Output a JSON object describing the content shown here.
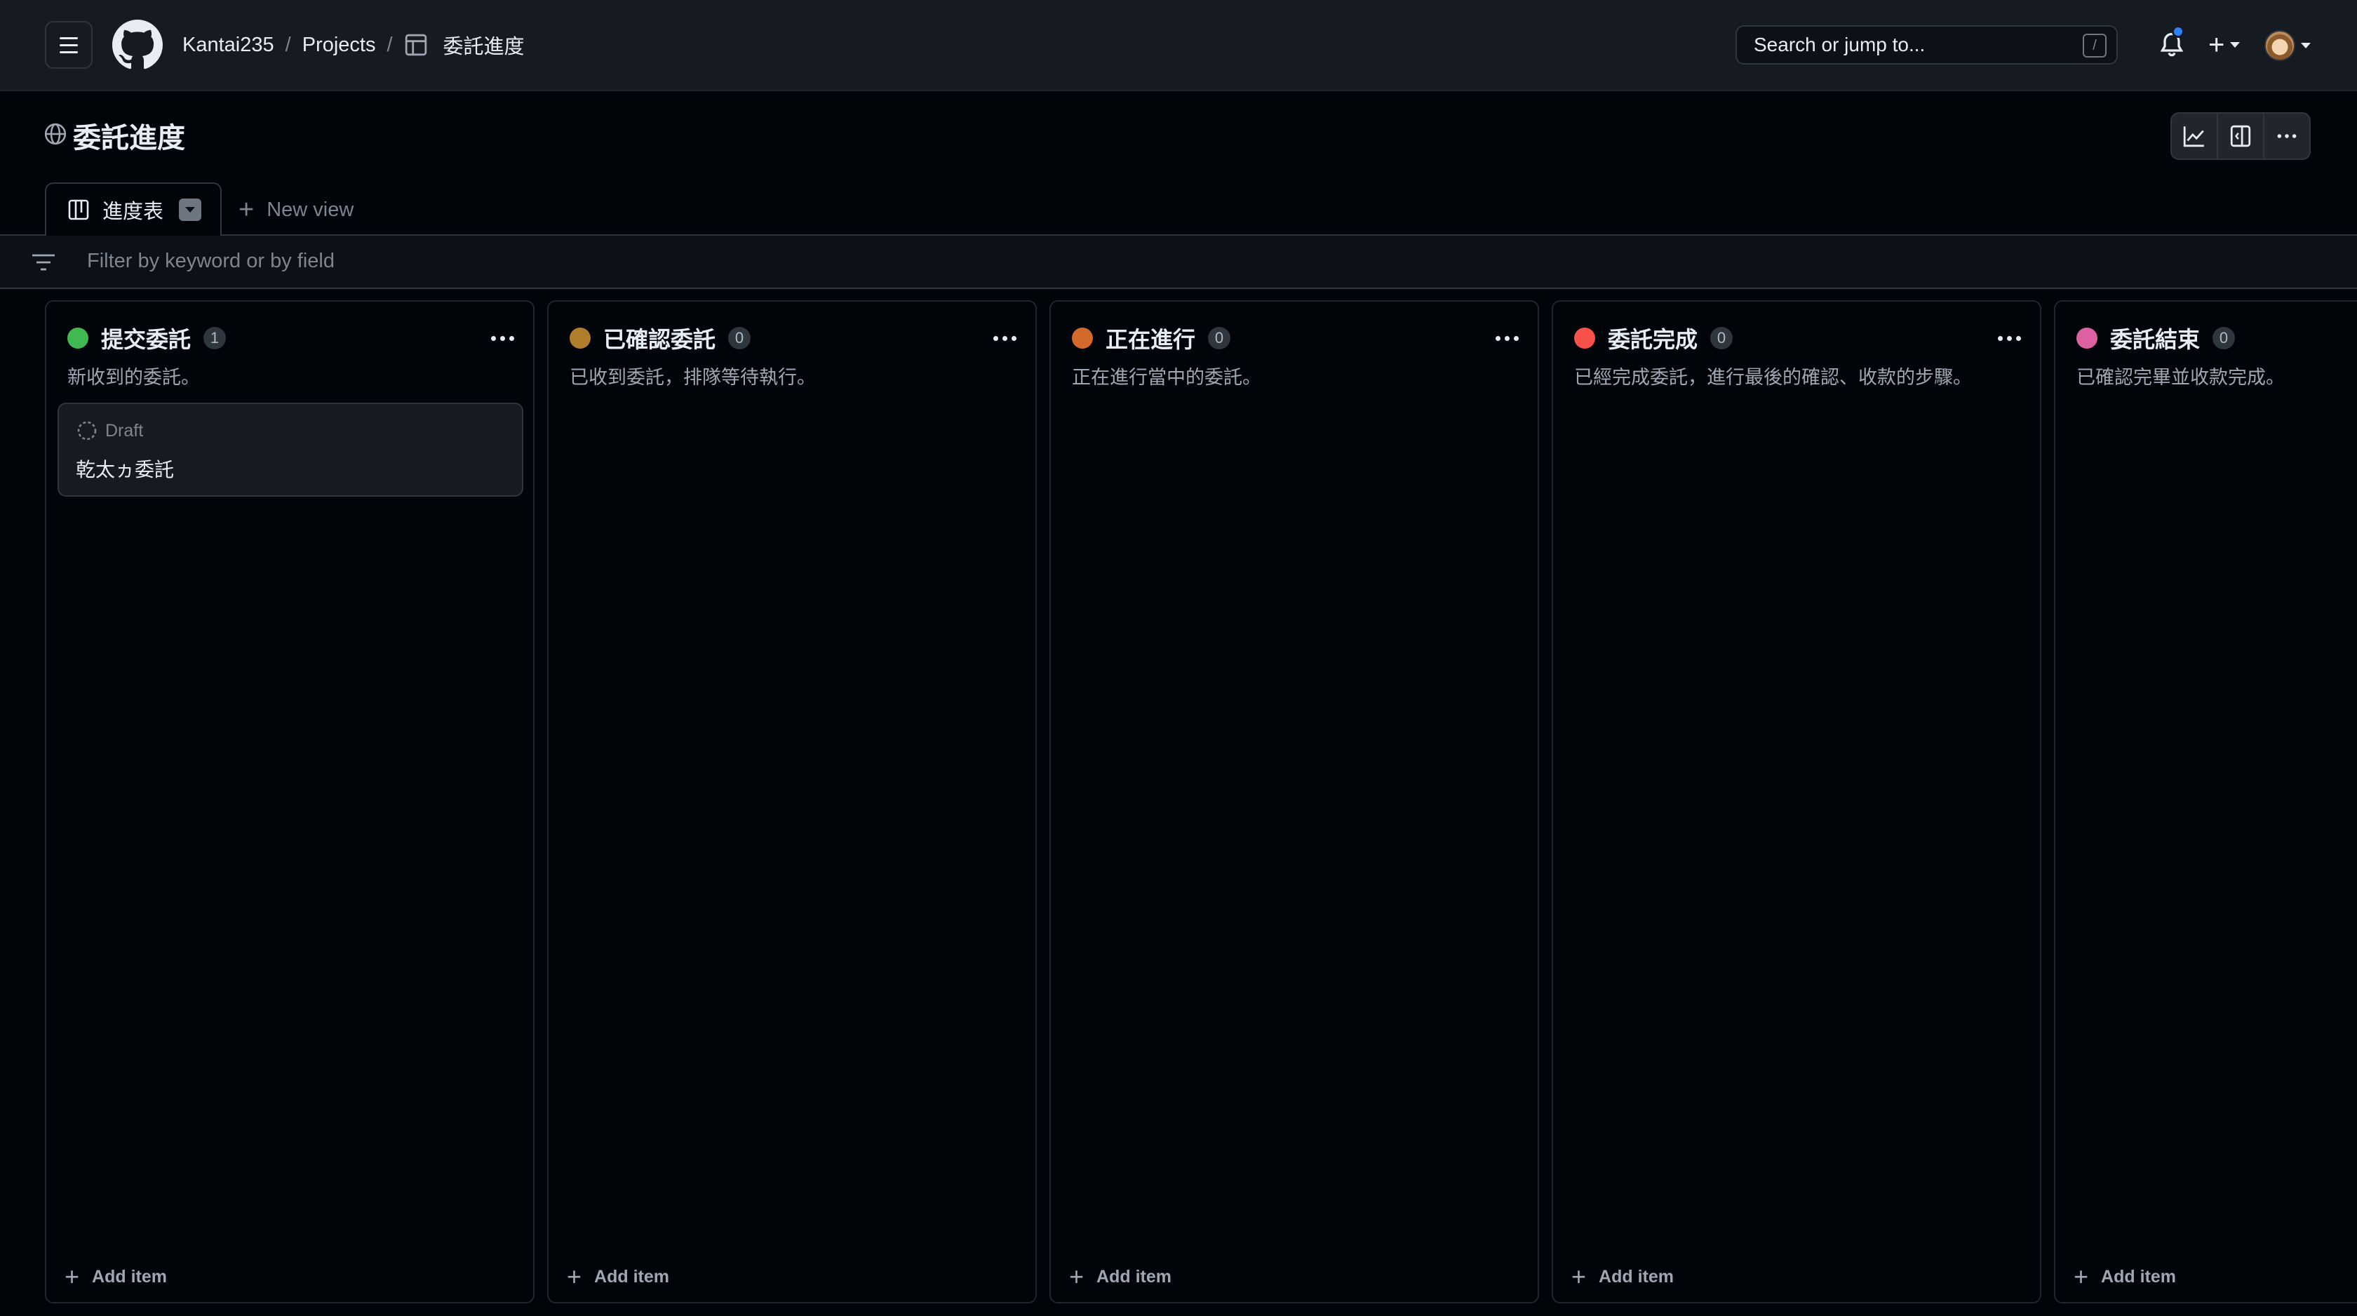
{
  "header": {
    "breadcrumb": {
      "owner": "Kantai235",
      "sep1": "/",
      "projects": "Projects",
      "sep2": "/",
      "current": "委託進度"
    },
    "search_placeholder": "Search or jump to...",
    "search_shortcut": "/",
    "new_button": "+"
  },
  "project": {
    "title": "委託進度"
  },
  "views": {
    "active_tab": "進度表",
    "new_view_label": "New view",
    "new_view_plus": "+"
  },
  "filter": {
    "placeholder": "Filter by keyword or by field"
  },
  "board": {
    "add_item_label": "Add item",
    "add_item_plus": "+",
    "columns": [
      {
        "title": "提交委託",
        "count": "1",
        "description": "新收到的委託。",
        "color": "#3fb950",
        "cards": [
          {
            "type": "Draft",
            "title": "乾太ヵ委託"
          }
        ]
      },
      {
        "title": "已確認委託",
        "count": "0",
        "description": "已收到委託，排隊等待執行。",
        "color": "#b07d2b",
        "cards": []
      },
      {
        "title": "正在進行",
        "count": "0",
        "description": "正在進行當中的委託。",
        "color": "#d2692a",
        "cards": []
      },
      {
        "title": "委託完成",
        "count": "0",
        "description": "已經完成委託，進行最後的確認、收款的步驟。",
        "color": "#f85149",
        "cards": []
      },
      {
        "title": "委託結束",
        "count": "0",
        "description": "已確認完畢並收款完成。",
        "color": "#db61a2",
        "cards": []
      }
    ]
  },
  "icons": {
    "menu": "hamburger-icon",
    "logo": "github-logo-icon",
    "table": "table-icon",
    "bell": "bell-icon",
    "globe": "globe-icon",
    "chart": "chart-icon",
    "panel": "side-panel-icon",
    "more": "kebab-icon",
    "board": "board-view-icon",
    "filter": "filter-icon",
    "draft": "draft-icon"
  },
  "colors": {
    "accent": "#2f81f7",
    "background": "#010409",
    "header": "#161b22"
  }
}
